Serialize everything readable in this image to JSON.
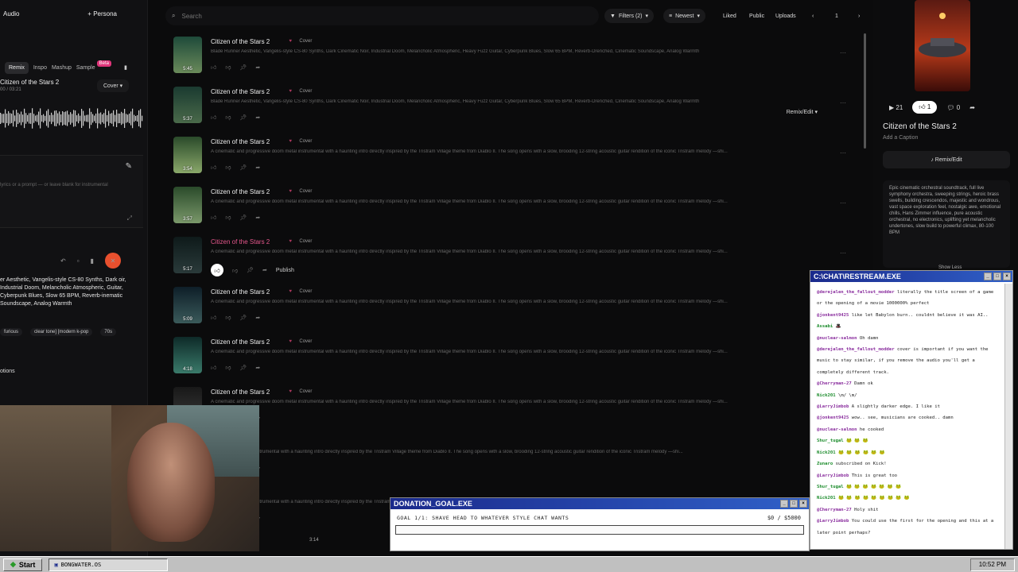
{
  "left_panel": {
    "tab_audio": "Audio",
    "tab_persona": "Persona",
    "chips": [
      "Remix",
      "Inspo",
      "Mashup",
      "Sample"
    ],
    "beta": "Beta",
    "song_name": "Citizen of the Stars 2",
    "song_time": "00 / 03:21",
    "cover_select": "Cover",
    "lyrics_placeholder": "lyrics or a prompt — or leave blank for instrumental",
    "style_text": "er Aesthetic, Vangelis-style CS-80 Synths, Dark oir, Industrial Doom, Melancholic Atmospheric, Guitar, Cyberpunk Blues, Slow 65 BPM, Reverb-inematic Soundscape, Analog Warmth",
    "tags": [
      "furious",
      "clear tone] [modern k-pop",
      "70s"
    ],
    "options_label": "otions"
  },
  "topbar": {
    "search_placeholder": "Search",
    "filters": "Filters (2)",
    "sort": "Newest",
    "liked": "Liked",
    "public": "Public",
    "uploads": "Uploads",
    "page": "1"
  },
  "songs": [
    {
      "title": "Citizen of the Stars 2",
      "tag": "Cover",
      "duration": "5:45",
      "desc": "Blade Runner Aesthetic, Vangelis-style CS-80 Synths, Dark Cinematic Noir, Industrial Doom, Melancholic Atmospheric, Heavy Fuzz Guitar, Cyberpunk Blues, Slow 65 BPM, Reverb-Drenched, Cinematic Soundscape, Analog Warmth",
      "color_top": "#1e4a3a",
      "color_bot": "#6a8a5a"
    },
    {
      "title": "Citizen of the Stars 2",
      "tag": "Cover",
      "duration": "5:37",
      "desc": "Blade Runner Aesthetic, Vangelis-style CS-80 Synths, Dark Cinematic Noir, Industrial Doom, Melancholic Atmospheric, Heavy Fuzz Guitar, Cyberpunk Blues, Slow 65 BPM, Reverb-Drenched, Cinematic Soundscape, Analog Warmth",
      "color_top": "#1a3a30",
      "color_bot": "#4a6a4a",
      "remix": "Remix/Edit"
    },
    {
      "title": "Citizen of the Stars 2",
      "tag": "Cover",
      "duration": "3:54",
      "desc": "A cinematic and progressive doom metal instrumental with a haunting intro directly inspired by the Tristram Village theme from Diablo II. The song opens with a slow, brooding 12-string acoustic guitar rendition of the iconic Tristram melody —shi...",
      "color_top": "#2a4a2a",
      "color_bot": "#8aa86a"
    },
    {
      "title": "Citizen of the Stars 2",
      "tag": "Cover",
      "duration": "3:57",
      "desc": "A cinematic and progressive doom metal instrumental with a haunting intro directly inspired by the Tristram Village theme from Diablo II. The song opens with a slow, brooding 12-string acoustic guitar rendition of the iconic Tristram melody —shi...",
      "color_top": "#2a4a2a",
      "color_bot": "#7a986a"
    },
    {
      "title": "Citizen of the Stars 2",
      "tag": "Cover",
      "duration": "5:17",
      "desc": "A cinematic and progressive doom metal instrumental with a haunting intro directly inspired by the Tristram Village theme from Diablo II. The song opens with a slow, brooding 12-string acoustic guitar rendition of the iconic Tristram melody —shi...",
      "color_top": "#0e1a1a",
      "color_bot": "#2a3a3a",
      "publish": "Publish",
      "active": true
    },
    {
      "title": "Citizen of the Stars 2",
      "tag": "Cover",
      "duration": "5:09",
      "desc": "A cinematic and progressive doom metal instrumental with a haunting intro directly inspired by the Tristram Village theme from Diablo II. The song opens with a slow, brooding 12-string acoustic guitar rendition of the iconic Tristram melody —shi...",
      "color_top": "#0e1e28",
      "color_bot": "#3a5a5a"
    },
    {
      "title": "Citizen of the Stars 2",
      "tag": "Cover",
      "duration": "4:18",
      "desc": "A cinematic and progressive doom metal instrumental with a haunting intro directly inspired by the Tristram Village theme from Diablo II. The song opens with a slow, brooding 12-string acoustic guitar rendition of the iconic Tristram melody —shi...",
      "color_top": "#0e2a28",
      "color_bot": "#3a7a6a"
    },
    {
      "title": "Citizen of the Stars 2",
      "tag": "Cover",
      "duration": "",
      "desc": "A cinematic and progressive doom metal instrumental with a haunting intro directly inspired by the Tristram Village theme from Diablo II. The song opens with a slow, brooding 12-string acoustic guitar rendition of the iconic Tristram melody —shi...",
      "color_top": "#181818",
      "color_bot": "#3a3a3a"
    },
    {
      "title": "s 2",
      "tag": "Cover",
      "duration": "",
      "desc": "ressive doom metal instrumental with a haunting intro directly inspired by the Tristram Village theme from Diablo II. The song opens with a slow, brooding 12-string acoustic guitar rendition of the iconic Tristram melody —shi...",
      "color_top": "#181818",
      "color_bot": "#3a3a3a"
    },
    {
      "title": "s 2",
      "tag": "Cover",
      "duration": "",
      "desc": "ressive doom metal instrumental with a haunting intro directly inspired by the Tristram Village theme from Diablo II...",
      "color_top": "#181818",
      "color_bot": "#3a3a3a"
    }
  ],
  "right_panel": {
    "plays": "21",
    "likes": "1",
    "comments": "0",
    "title": "Citizen of the Stars 2",
    "caption": "Add a Caption",
    "remix_button": "Remix/Edit",
    "description": "Epic cinematic orchestral soundtrack, full live symphony orchestra, sweeping strings, heroic brass swells, building crescendos, majestic and wondrous, vast space exploration feel, nostalgic awe, emotional chills, Hans Zimmer influence, pure acoustic orchestral, no electronics, uplifting yet melancholic undertones, slow build to powerful climax, 80-100 BPM",
    "show_less": "Show Less"
  },
  "chat": {
    "title": "C:\\CHAT\\RESTREAM.EXE",
    "messages": [
      {
        "user": "@derejalen_the_fallout_modder",
        "text": "literally the title screen of a game or the opening of a movie 1000000% perfect"
      },
      {
        "user": "@jonkent9425",
        "text": "like let Babylon burn.. couldnt believe it was AI.."
      },
      {
        "user": "Assabi",
        "text": "🎩"
      },
      {
        "user": "@nuclear-salmon",
        "text": "Oh damn"
      },
      {
        "user": "@derejalen_the_fallout_modder",
        "text": "cover is important if you want the music to stay similar, if you remove the audio you'll get a completely different track."
      },
      {
        "user": "@Cherryman-27",
        "text": "Damn ok"
      },
      {
        "user": "Nick201",
        "text": "\\m/ \\m/"
      },
      {
        "user": "@LarryJimbob",
        "text": "A slightly darker edge. I like it"
      },
      {
        "user": "@jonkent9425",
        "text": "wow.. see, musicians are cooked.. damn"
      },
      {
        "user": "@nuclear-salmon",
        "text": "he cooked"
      },
      {
        "user": "Shur_tugal",
        "text": "🐸 🐸 🐸"
      },
      {
        "user": "Nick201",
        "text": "🐸 🐸 🐸 🐸 🐸 🐸"
      },
      {
        "user": "Zunaro",
        "text": "subscribed on Kick!"
      },
      {
        "user": "@LarryJimbob",
        "text": "This is great too"
      },
      {
        "user": "Shur_tugal",
        "text": "🐸 🐸 🐸 🐸 🐸 🐸 🐸"
      },
      {
        "user": "Nick201",
        "text": "🐸 🐸 🐸 🐸 🐸 🐸 🐸 🐸 🐸"
      },
      {
        "user": "@Cherryman-27",
        "text": "Holy shit"
      },
      {
        "user": "@LarryJimbob",
        "text": "You could use the first for the opening and this at a later point perhaps?"
      }
    ]
  },
  "donation": {
    "title": "DONATION_GOAL.EXE",
    "goal": "GOAL 1/1: SHAVE HEAD TO WHATEVER STYLE CHAT WANTS",
    "amount": "$0 / $5000",
    "progress": 0
  },
  "player": {
    "time": "3:14"
  },
  "taskbar": {
    "start": "Start",
    "task": "BONGWATER.OS",
    "clock": "10:52 PM"
  }
}
